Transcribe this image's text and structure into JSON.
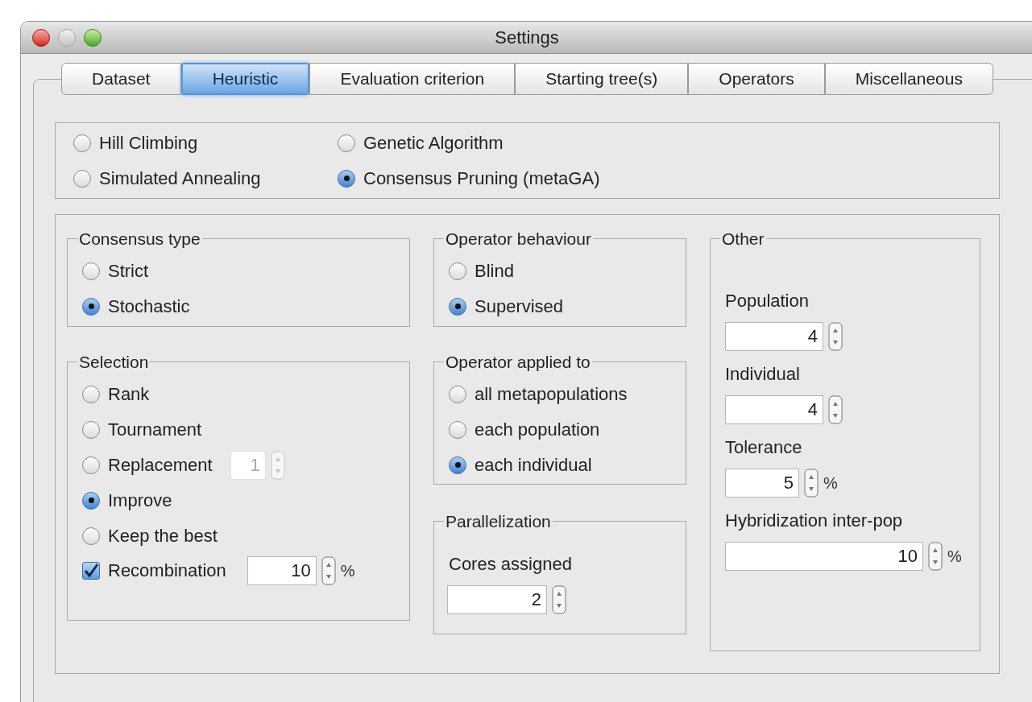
{
  "window": {
    "title": "Settings"
  },
  "tabs": [
    {
      "label": "Dataset",
      "selected": false
    },
    {
      "label": "Heuristic",
      "selected": true
    },
    {
      "label": "Evaluation criterion",
      "selected": false
    },
    {
      "label": "Starting tree(s)",
      "selected": false
    },
    {
      "label": "Operators",
      "selected": false
    },
    {
      "label": "Miscellaneous",
      "selected": false
    }
  ],
  "heuristics": [
    {
      "label": "Hill Climbing",
      "selected": false
    },
    {
      "label": "Simulated Annealing",
      "selected": false
    },
    {
      "label": "Genetic Algorithm",
      "selected": false
    },
    {
      "label": "Consensus Pruning (metaGA)",
      "selected": true
    }
  ],
  "consensus_type": {
    "title": "Consensus type",
    "options": [
      {
        "label": "Strict",
        "selected": false
      },
      {
        "label": "Stochastic",
        "selected": true
      }
    ]
  },
  "selection": {
    "title": "Selection",
    "options": [
      {
        "label": "Rank",
        "selected": false
      },
      {
        "label": "Tournament",
        "selected": false
      },
      {
        "label": "Replacement",
        "selected": false,
        "spinner": {
          "value": "1",
          "disabled": true
        }
      },
      {
        "label": "Improve",
        "selected": true
      },
      {
        "label": "Keep the best",
        "selected": false
      }
    ],
    "recombination": {
      "label": "Recombination",
      "checked": true,
      "value": "10",
      "unit": "%"
    }
  },
  "operator_behaviour": {
    "title": "Operator behaviour",
    "options": [
      {
        "label": "Blind",
        "selected": false
      },
      {
        "label": "Supervised",
        "selected": true
      }
    ]
  },
  "operator_applied_to": {
    "title": "Operator applied to",
    "options": [
      {
        "label": "all metapopulations",
        "selected": false
      },
      {
        "label": "each population",
        "selected": false
      },
      {
        "label": "each individual",
        "selected": true
      }
    ]
  },
  "parallelization": {
    "title": "Parallelization",
    "fields": [
      {
        "label": "Cores assigned",
        "value": "2"
      }
    ]
  },
  "other": {
    "title": "Other",
    "fields": [
      {
        "label": "Population",
        "value": "4"
      },
      {
        "label": "Individual",
        "value": "4"
      },
      {
        "label": "Tolerance",
        "value": "5",
        "unit": "%"
      },
      {
        "label": "Hybridization inter-pop",
        "value": "10",
        "unit": "%"
      }
    ]
  }
}
